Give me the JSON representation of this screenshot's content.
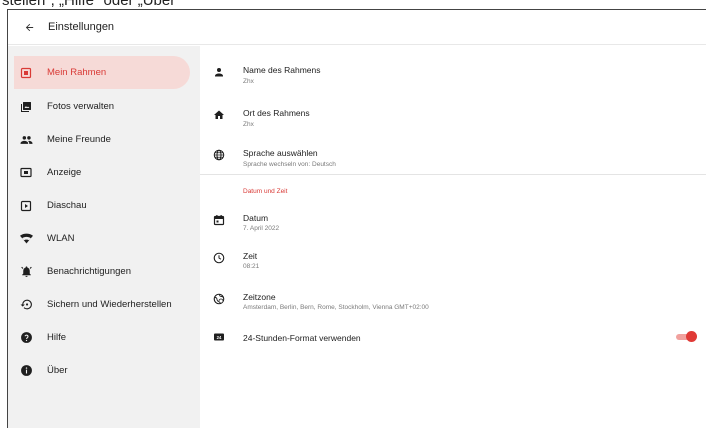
{
  "caption": {
    "text": "stellen\", „Hilfe\" oder „Über\""
  },
  "appbar": {
    "title": "Einstellungen",
    "back_icon": "arrow-back-icon"
  },
  "sidebar": {
    "items": [
      {
        "label": "Mein Rahmen",
        "icon": "frame-icon",
        "active": true
      },
      {
        "label": "Fotos verwalten",
        "icon": "photo-library-icon",
        "active": false
      },
      {
        "label": "Meine Freunde",
        "icon": "people-icon",
        "active": false
      },
      {
        "label": "Anzeige",
        "icon": "display-icon",
        "active": false
      },
      {
        "label": "Diaschau",
        "icon": "slideshow-icon",
        "active": false
      },
      {
        "label": "WLAN",
        "icon": "wifi-icon",
        "active": false
      },
      {
        "label": "Benachrichtigungen",
        "icon": "bell-icon",
        "active": false
      },
      {
        "label": "Sichern und Wiederherstellen",
        "icon": "backup-restore-icon",
        "active": false
      },
      {
        "label": "Hilfe",
        "icon": "help-icon",
        "active": false
      },
      {
        "label": "Über",
        "icon": "info-icon",
        "active": false
      }
    ]
  },
  "settings": {
    "frame_name": {
      "title": "Name des Rahmens",
      "value": "Zhx",
      "icon": "person-icon"
    },
    "frame_location": {
      "title": "Ort des Rahmens",
      "value": "Zhx",
      "icon": "home-icon"
    },
    "language": {
      "title": "Sprache auswählen",
      "value": "Sprache wechseln von: Deutsch",
      "icon": "globe-icon"
    },
    "section_date_time": "Datum und Zeit",
    "date": {
      "title": "Datum",
      "value": "7. April 2022",
      "icon": "calendar-icon"
    },
    "time": {
      "title": "Zeit",
      "value": "08:21",
      "icon": "clock-icon"
    },
    "timezone": {
      "title": "Zeitzone",
      "value": "Amsterdam, Berlin, Bern, Rome, Stockholm, Vienna GMT+02:00",
      "icon": "timezone-globe-icon"
    },
    "format24": {
      "title": "24-Stunden-Format verwenden",
      "icon": "format-24h-icon",
      "enabled": true
    }
  },
  "colors": {
    "accent": "#e03a36",
    "active_bg": "#f6dad7",
    "sidebar_bg": "#f1f1f1"
  }
}
